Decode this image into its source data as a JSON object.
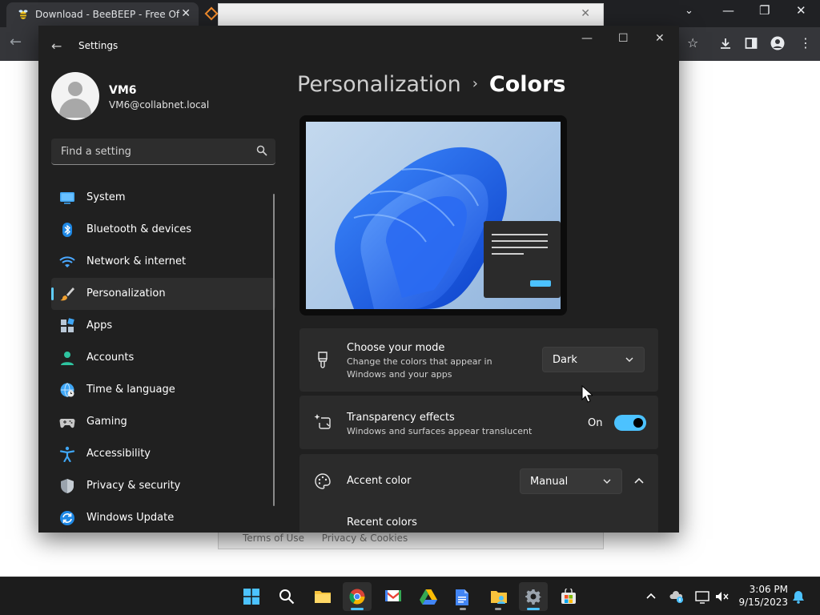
{
  "browser": {
    "tab_title": "Download - BeeBEEP - Free Office",
    "terms_link": "Terms of Use",
    "privacy_link": "Privacy & Cookies"
  },
  "window": {
    "title": "Settings",
    "back_label": "←",
    "minimize": "—",
    "maximize": "☐",
    "close": "✕"
  },
  "user": {
    "name": "VM6",
    "email": "VM6@collabnet.local"
  },
  "search": {
    "placeholder": "Find a setting"
  },
  "nav": {
    "items": [
      {
        "label": "System",
        "icon": "monitor-icon"
      },
      {
        "label": "Bluetooth & devices",
        "icon": "bluetooth-icon"
      },
      {
        "label": "Network & internet",
        "icon": "wifi-icon"
      },
      {
        "label": "Personalization",
        "icon": "brush-icon",
        "active": true
      },
      {
        "label": "Apps",
        "icon": "apps-icon"
      },
      {
        "label": "Accounts",
        "icon": "person-icon"
      },
      {
        "label": "Time & language",
        "icon": "globe-clock-icon"
      },
      {
        "label": "Gaming",
        "icon": "gamepad-icon"
      },
      {
        "label": "Accessibility",
        "icon": "accessibility-icon"
      },
      {
        "label": "Privacy & security",
        "icon": "shield-icon"
      },
      {
        "label": "Windows Update",
        "icon": "sync-icon"
      }
    ]
  },
  "breadcrumb": {
    "parent": "Personalization",
    "separator": "›",
    "current": "Colors"
  },
  "mode_card": {
    "title": "Choose your mode",
    "description": "Change the colors that appear in Windows and your apps",
    "value": "Dark"
  },
  "transparency_card": {
    "title": "Transparency effects",
    "description": "Windows and surfaces appear translucent",
    "state_label": "On",
    "enabled": true
  },
  "accent_card": {
    "title": "Accent color",
    "value": "Manual",
    "expanded": true
  },
  "recent_colors": {
    "label": "Recent colors"
  },
  "clock": {
    "time": "3:06 PM",
    "date": "9/15/2023"
  },
  "colors": {
    "accent": "#4cc2ff",
    "window_bg": "#202020",
    "card_bg": "#2b2b2b"
  }
}
